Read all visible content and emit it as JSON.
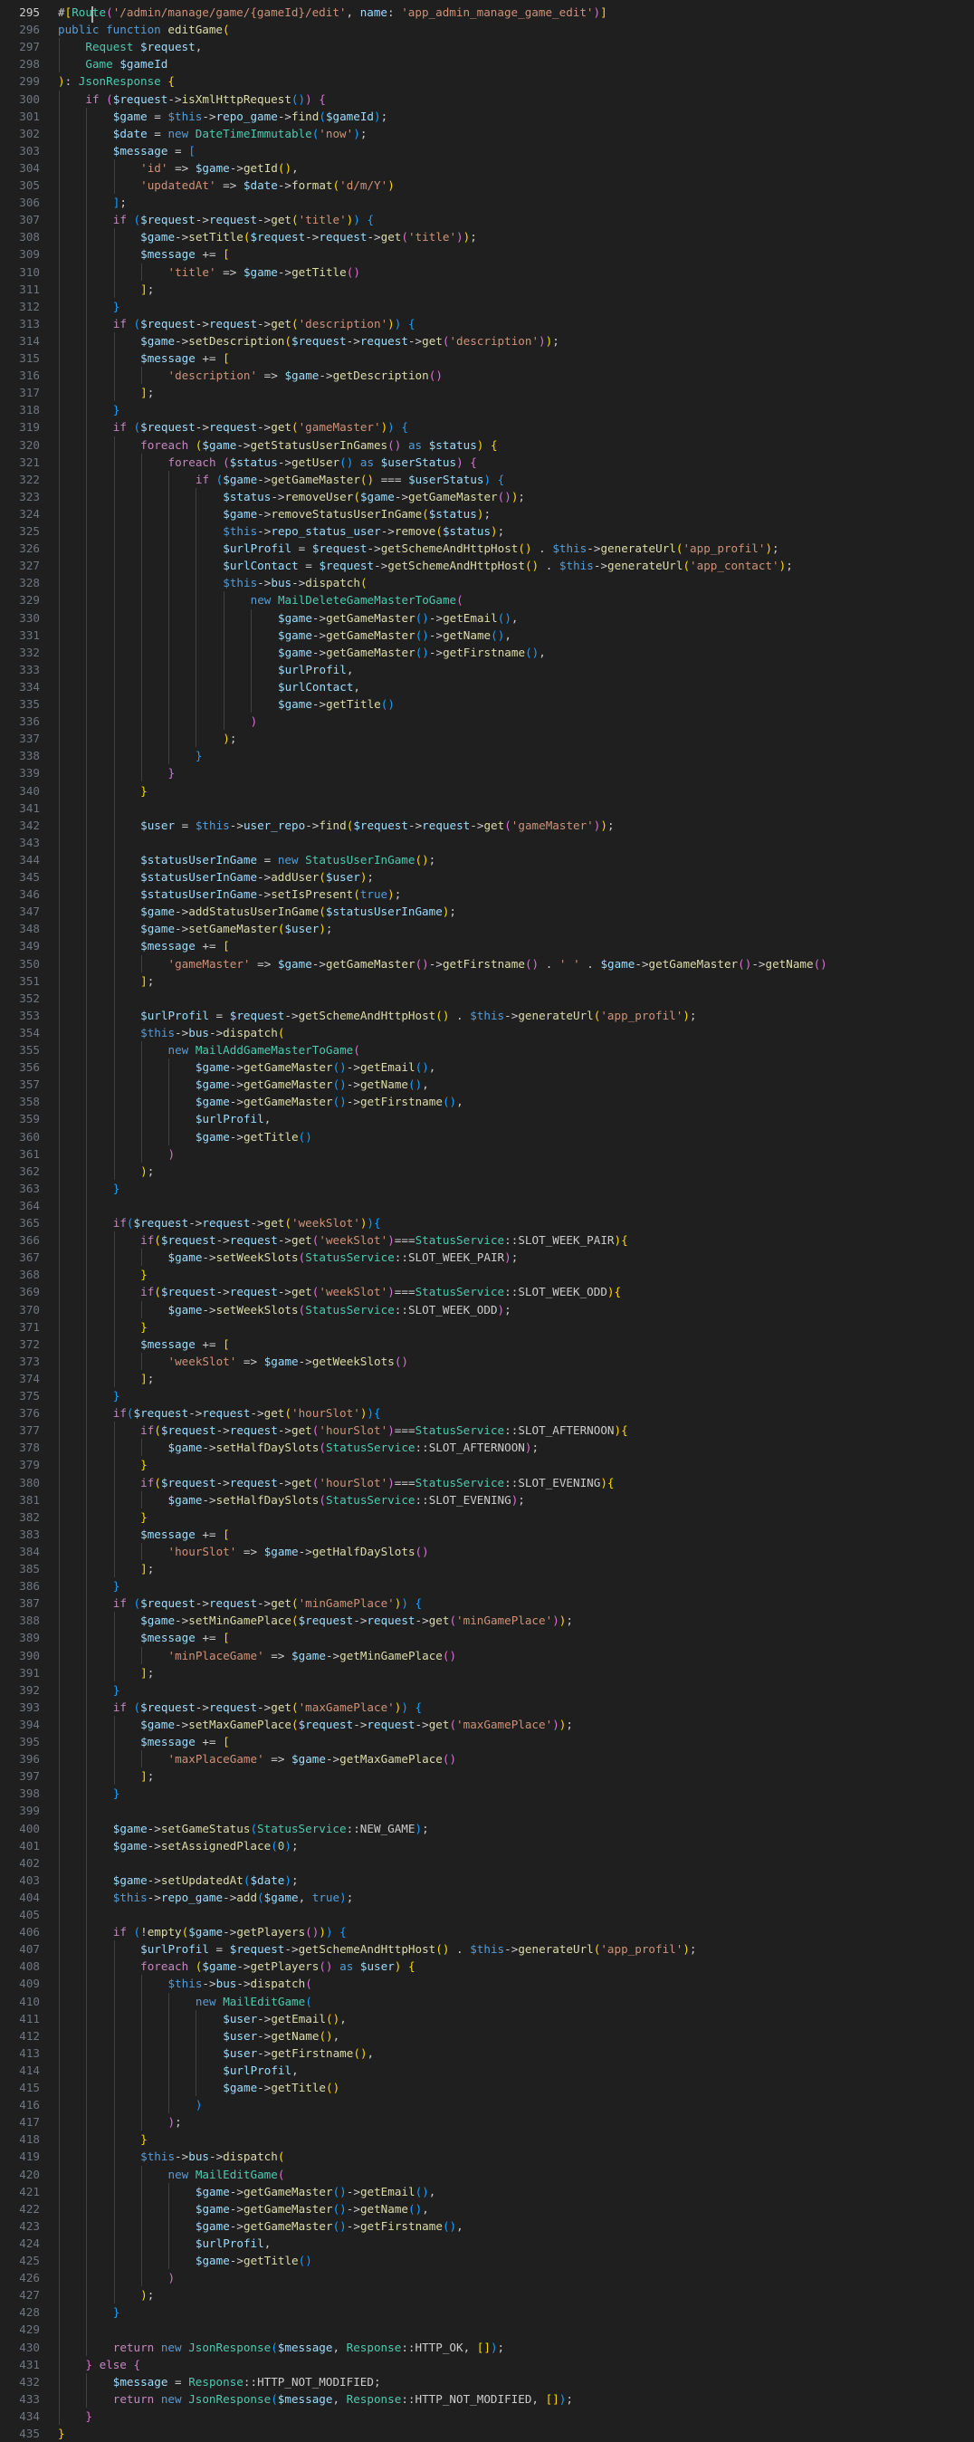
{
  "editor": {
    "first_line": 295,
    "active_line": 295,
    "lines": [
      "#[Route('/admin/manage/game/{gameId}/edit', name: 'app_admin_manage_game_edit')]",
      "public function editGame(",
      "    Request $request,",
      "    Game $gameId",
      "): JsonResponse {",
      "    if ($request->isXmlHttpRequest()) {",
      "        $game = $this->repo_game->find($gameId);",
      "        $date = new DateTimeImmutable('now');",
      "        $message = [",
      "            'id' => $game->getId(),",
      "            'updatedAt' => $date->format('d/m/Y')",
      "        ];",
      "        if ($request->request->get('title')) {",
      "            $game->setTitle($request->request->get('title'));",
      "            $message += [",
      "                'title' => $game->getTitle()",
      "            ];",
      "        }",
      "        if ($request->request->get('description')) {",
      "            $game->setDescription($request->request->get('description'));",
      "            $message += [",
      "                'description' => $game->getDescription()",
      "            ];",
      "        }",
      "        if ($request->request->get('gameMaster')) {",
      "            foreach ($game->getStatusUserInGames() as $status) {",
      "                foreach ($status->getUser() as $userStatus) {",
      "                    if ($game->getGameMaster() === $userStatus) {",
      "                        $status->removeUser($game->getGameMaster());",
      "                        $game->removeStatusUserInGame($status);",
      "                        $this->repo_status_user->remove($status);",
      "                        $urlProfil = $request->getSchemeAndHttpHost() . $this->generateUrl('app_profil');",
      "                        $urlContact = $request->getSchemeAndHttpHost() . $this->generateUrl('app_contact');",
      "                        $this->bus->dispatch(",
      "                            new MailDeleteGameMasterToGame(",
      "                                $game->getGameMaster()->getEmail(),",
      "                                $game->getGameMaster()->getName(),",
      "                                $game->getGameMaster()->getFirstname(),",
      "                                $urlProfil,",
      "                                $urlContact,",
      "                                $game->getTitle()",
      "                            )",
      "                        );",
      "                    }",
      "                }",
      "            }",
      "",
      "            $user = $this->user_repo->find($request->request->get('gameMaster'));",
      "",
      "            $statusUserInGame = new StatusUserInGame();",
      "            $statusUserInGame->addUser($user);",
      "            $statusUserInGame->setIsPresent(true);",
      "            $game->addStatusUserInGame($statusUserInGame);",
      "            $game->setGameMaster($user);",
      "            $message += [",
      "                'gameMaster' => $game->getGameMaster()->getFirstname() . ' ' . $game->getGameMaster()->getName()",
      "            ];",
      "",
      "            $urlProfil = $request->getSchemeAndHttpHost() . $this->generateUrl('app_profil');",
      "            $this->bus->dispatch(",
      "                new MailAddGameMasterToGame(",
      "                    $game->getGameMaster()->getEmail(),",
      "                    $game->getGameMaster()->getName(),",
      "                    $game->getGameMaster()->getFirstname(),",
      "                    $urlProfil,",
      "                    $game->getTitle()",
      "                )",
      "            );",
      "        }",
      "",
      "        if($request->request->get('weekSlot')){",
      "            if($request->request->get('weekSlot')===StatusService::SLOT_WEEK_PAIR){",
      "                $game->setWeekSlots(StatusService::SLOT_WEEK_PAIR);",
      "            }",
      "            if($request->request->get('weekSlot')===StatusService::SLOT_WEEK_ODD){",
      "                $game->setWeekSlots(StatusService::SLOT_WEEK_ODD);",
      "            }",
      "            $message += [",
      "                'weekSlot' => $game->getWeekSlots()",
      "            ];",
      "        }",
      "        if($request->request->get('hourSlot')){",
      "            if($request->request->get('hourSlot')===StatusService::SLOT_AFTERNOON){",
      "                $game->setHalfDaySlots(StatusService::SLOT_AFTERNOON);",
      "            }",
      "            if($request->request->get('hourSlot')===StatusService::SLOT_EVENING){",
      "                $game->setHalfDaySlots(StatusService::SLOT_EVENING);",
      "            }",
      "            $message += [",
      "                'hourSlot' => $game->getHalfDaySlots()",
      "            ];",
      "        }",
      "        if ($request->request->get('minGamePlace')) {",
      "            $game->setMinGamePlace($request->request->get('minGamePlace'));",
      "            $message += [",
      "                'minPlaceGame' => $game->getMinGamePlace()",
      "            ];",
      "        }",
      "        if ($request->request->get('maxGamePlace')) {",
      "            $game->setMaxGamePlace($request->request->get('maxGamePlace'));",
      "            $message += [",
      "                'maxPlaceGame' => $game->getMaxGamePlace()",
      "            ];",
      "        }",
      "",
      "        $game->setGameStatus(StatusService::NEW_GAME);",
      "        $game->setAssignedPlace(0);",
      "",
      "        $game->setUpdatedAt($date);",
      "        $this->repo_game->add($game, true);",
      "",
      "        if (!empty($game->getPlayers())) {",
      "            $urlProfil = $request->getSchemeAndHttpHost() . $this->generateUrl('app_profil');",
      "            foreach ($game->getPlayers() as $user) {",
      "                $this->bus->dispatch(",
      "                    new MailEditGame(",
      "                        $user->getEmail(),",
      "                        $user->getName(),",
      "                        $user->getFirstname(),",
      "                        $urlProfil,",
      "                        $game->getTitle()",
      "                    )",
      "                );",
      "            }",
      "            $this->bus->dispatch(",
      "                new MailEditGame(",
      "                    $game->getGameMaster()->getEmail(),",
      "                    $game->getGameMaster()->getName(),",
      "                    $game->getGameMaster()->getFirstname(),",
      "                    $urlProfil,",
      "                    $game->getTitle()",
      "                )",
      "            );",
      "        }",
      "",
      "        return new JsonResponse($message, Response::HTTP_OK, []);",
      "    } else {",
      "        $message = Response::HTTP_NOT_MODIFIED;",
      "        return new JsonResponse($message, Response::HTTP_NOT_MODIFIED, []);",
      "    }",
      "}"
    ]
  },
  "colors": {
    "background": "#1f1f1f",
    "line_number": "#6e7681",
    "line_number_active": "#cccccc",
    "default": "#cccccc",
    "variable": "#9cdcfe",
    "keyword_storage": "#569cd6",
    "keyword_control": "#c586c0",
    "function": "#dcdcaa",
    "class": "#4ec9b0",
    "string": "#ce9178",
    "number": "#b5cea8",
    "this": "#569cd6",
    "bracket_1": "#ffd700",
    "bracket_2": "#da70d6",
    "bracket_3": "#179fff"
  }
}
